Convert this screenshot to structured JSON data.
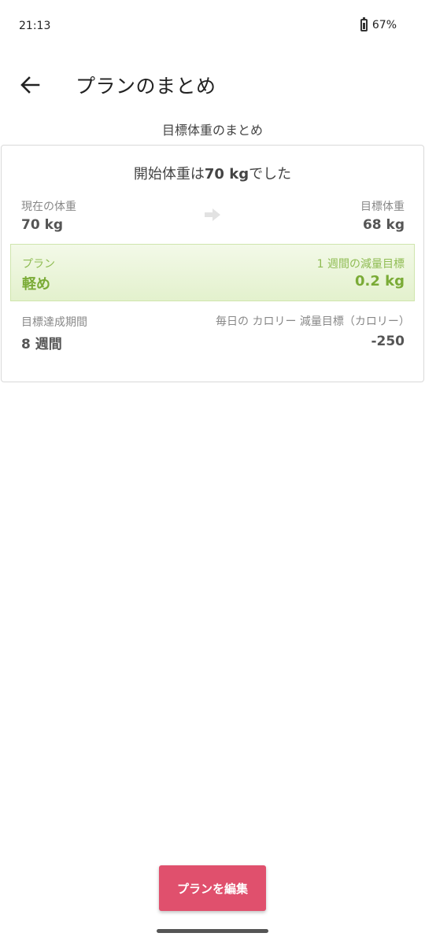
{
  "status_bar": {
    "time": "21:13",
    "battery": "67%"
  },
  "app_bar": {
    "title": "プランのまとめ"
  },
  "section_title": "目標体重のまとめ",
  "card": {
    "start_prefix": "開始体重は",
    "start_value": "70 kg",
    "start_suffix": "でした",
    "current_label": "現在の体重",
    "current_value": "70 kg",
    "target_label": "目標体重",
    "target_value": "68 kg",
    "plan_label": "プラン",
    "plan_value": "軽め",
    "weekly_label": "1 週間の減量目標",
    "weekly_value": "0.2 kg",
    "period_label": "目標達成期間",
    "period_value": "8 週間",
    "calorie_label": "毎日の カロリー 減量目標（カロリー）",
    "calorie_value": "-250"
  },
  "edit_button": "プランを編集",
  "colors": {
    "accent": "#e0506d",
    "plan_green": "#7aab36",
    "band_bg": "#e3f1cd"
  },
  "icons": {
    "back": "arrow-left-icon",
    "arrow": "arrow-right-icon",
    "battery": "battery-icon"
  }
}
